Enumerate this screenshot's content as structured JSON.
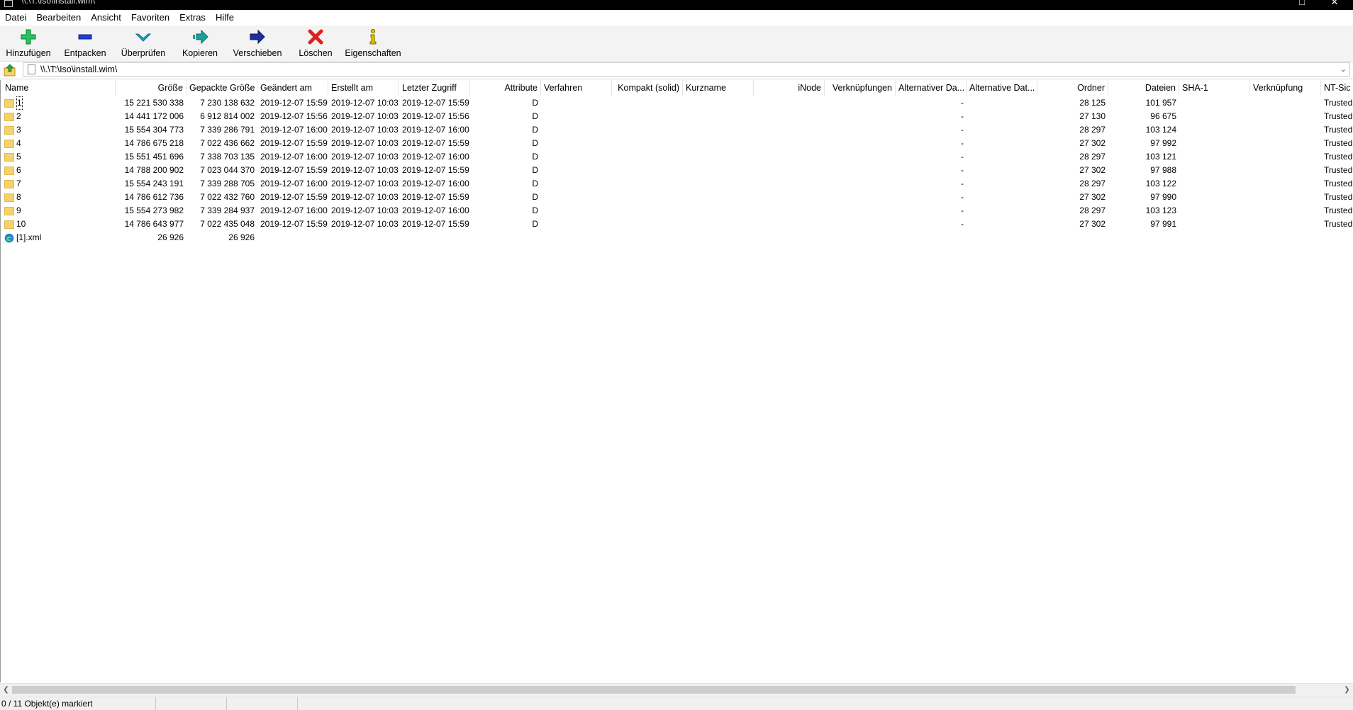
{
  "window": {
    "title": "\\\\.\\T:\\Iso\\install.wim\\",
    "maximize": "□",
    "close": "✕"
  },
  "menu": [
    "Datei",
    "Bearbeiten",
    "Ansicht",
    "Favoriten",
    "Extras",
    "Hilfe"
  ],
  "toolbar": {
    "add": "Hinzufügen",
    "extract": "Entpacken",
    "test": "Überprüfen",
    "copy": "Kopieren",
    "move": "Verschieben",
    "delete": "Löschen",
    "info": "Eigenschaften"
  },
  "address": {
    "path": "\\\\.\\T:\\Iso\\install.wim\\"
  },
  "columns": {
    "name": "Name",
    "size": "Größe",
    "packed": "Gepackte Größe",
    "modified": "Geändert am",
    "created": "Erstellt am",
    "accessed": "Letzter Zugriff",
    "attributes": "Attribute",
    "method": "Verfahren",
    "solid": "Kompakt (solid)",
    "shortname": "Kurzname",
    "inode": "iNode",
    "links": "Verknüpfungen",
    "altstream1": "Alternativer Da...",
    "altstream2": "Alternative Dat...",
    "folders": "Ordner",
    "files": "Dateien",
    "sha1": "SHA-1",
    "link": "Verknüpfung",
    "ntsec": "NT-Sic"
  },
  "rows": [
    {
      "name": "1",
      "type": "folder",
      "size": "15 221 530 338",
      "packed": "7 230 138 632",
      "modified": "2019-12-07 15:59",
      "created": "2019-12-07 10:03",
      "accessed": "2019-12-07 15:59",
      "attr": "D",
      "alt": "-",
      "folders": "28 125",
      "files": "101 957",
      "ntsec": "Trusted"
    },
    {
      "name": "2",
      "type": "folder",
      "size": "14 441 172 006",
      "packed": "6 912 814 002",
      "modified": "2019-12-07 15:56",
      "created": "2019-12-07 10:03",
      "accessed": "2019-12-07 15:56",
      "attr": "D",
      "alt": "-",
      "folders": "27 130",
      "files": "96 675",
      "ntsec": "Trusted"
    },
    {
      "name": "3",
      "type": "folder",
      "size": "15 554 304 773",
      "packed": "7 339 286 791",
      "modified": "2019-12-07 16:00",
      "created": "2019-12-07 10:03",
      "accessed": "2019-12-07 16:00",
      "attr": "D",
      "alt": "-",
      "folders": "28 297",
      "files": "103 124",
      "ntsec": "Trusted"
    },
    {
      "name": "4",
      "type": "folder",
      "size": "14 786 675 218",
      "packed": "7 022 436 662",
      "modified": "2019-12-07 15:59",
      "created": "2019-12-07 10:03",
      "accessed": "2019-12-07 15:59",
      "attr": "D",
      "alt": "-",
      "folders": "27 302",
      "files": "97 992",
      "ntsec": "Trusted"
    },
    {
      "name": "5",
      "type": "folder",
      "size": "15 551 451 696",
      "packed": "7 338 703 135",
      "modified": "2019-12-07 16:00",
      "created": "2019-12-07 10:03",
      "accessed": "2019-12-07 16:00",
      "attr": "D",
      "alt": "-",
      "folders": "28 297",
      "files": "103 121",
      "ntsec": "Trusted"
    },
    {
      "name": "6",
      "type": "folder",
      "size": "14 788 200 902",
      "packed": "7 023 044 370",
      "modified": "2019-12-07 15:59",
      "created": "2019-12-07 10:03",
      "accessed": "2019-12-07 15:59",
      "attr": "D",
      "alt": "-",
      "folders": "27 302",
      "files": "97 988",
      "ntsec": "Trusted"
    },
    {
      "name": "7",
      "type": "folder",
      "size": "15 554 243 191",
      "packed": "7 339 288 705",
      "modified": "2019-12-07 16:00",
      "created": "2019-12-07 10:03",
      "accessed": "2019-12-07 16:00",
      "attr": "D",
      "alt": "-",
      "folders": "28 297",
      "files": "103 122",
      "ntsec": "Trusted"
    },
    {
      "name": "8",
      "type": "folder",
      "size": "14 786 612 736",
      "packed": "7 022 432 760",
      "modified": "2019-12-07 15:59",
      "created": "2019-12-07 10:03",
      "accessed": "2019-12-07 15:59",
      "attr": "D",
      "alt": "-",
      "folders": "27 302",
      "files": "97 990",
      "ntsec": "Trusted"
    },
    {
      "name": "9",
      "type": "folder",
      "size": "15 554 273 982",
      "packed": "7 339 284 937",
      "modified": "2019-12-07 16:00",
      "created": "2019-12-07 10:03",
      "accessed": "2019-12-07 16:00",
      "attr": "D",
      "alt": "-",
      "folders": "28 297",
      "files": "103 123",
      "ntsec": "Trusted"
    },
    {
      "name": "10",
      "type": "folder",
      "size": "14 786 643 977",
      "packed": "7 022 435 048",
      "modified": "2019-12-07 15:59",
      "created": "2019-12-07 10:03",
      "accessed": "2019-12-07 15:59",
      "attr": "D",
      "alt": "-",
      "folders": "27 302",
      "files": "97 991",
      "ntsec": "Trusted"
    },
    {
      "name": "[1].xml",
      "type": "xml",
      "size": "26 926",
      "packed": "26 926",
      "modified": "",
      "created": "",
      "accessed": "",
      "attr": "",
      "alt": "",
      "folders": "",
      "files": "",
      "ntsec": ""
    }
  ],
  "status": {
    "selection": "0 / 11 Objekt(e) markiert"
  },
  "colors": {
    "folder": "#f6d36a",
    "add": "#22c55e",
    "delete": "#e11d1d",
    "extract": "#1d3fd8",
    "test": "#19a7c9"
  }
}
